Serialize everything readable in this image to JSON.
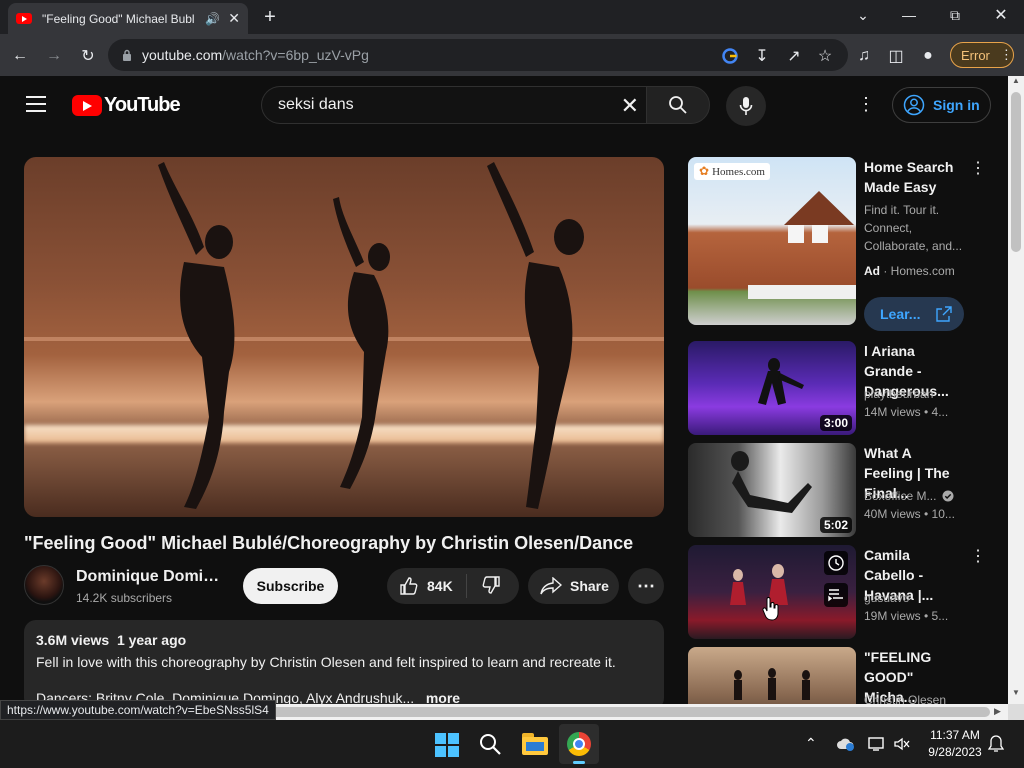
{
  "browser": {
    "tab_title": "\"Feeling Good\" Michael Bubl",
    "url_host": "youtube.com",
    "url_path": "/watch?v=6bp_uzV-vPg",
    "error_label": "Error",
    "status_url": "https://www.youtube.com/watch?v=EbeSNss5lS4"
  },
  "youtube": {
    "logo_text": "YouTube",
    "search_query": "seksi dans",
    "sign_in_label": "Sign in"
  },
  "video": {
    "title": "\"Feeling Good\" Michael Bublé/Choreography by Christin Olesen/Dance",
    "channel_name": "Dominique Domin...",
    "subscribers": "14.2K subscribers",
    "subscribe_label": "Subscribe",
    "likes": "84K",
    "share_label": "Share",
    "views": "3.6M views",
    "age": "1 year ago",
    "description": "Fell in love with this choreography by Christin Olesen and felt inspired to learn and recreate it.",
    "description_line2": "Dancers: Britny Cole, Dominique Domingo, Alyx Andrushuk...",
    "more_label": "more"
  },
  "sidebar": {
    "ad": {
      "title": "Home Search Made Easy",
      "text": "Find it. Tour it. Connect, Collaborate, and...",
      "ad_label": "Ad",
      "domain": "· Homes.com",
      "cta": "Lear...",
      "thumb_brand": "Homes.com"
    },
    "items": [
      {
        "title": "l Ariana Grande - Dangerous...",
        "channel": "playtheurban",
        "meta": "14M views  • 4...",
        "duration": "3:00"
      },
      {
        "title": "What A Feeling | The Final...",
        "channel": "Boxoffice M...",
        "meta": "40M views  • 10...",
        "duration": "5:02"
      },
      {
        "title": "Camila Cabello - Havana |...",
        "channel": "gusuavo",
        "meta": "19M views  • 5...",
        "duration": ""
      },
      {
        "title": "\"FEELING GOOD\" Micha...",
        "channel": "Christin Olesen",
        "meta": "",
        "duration": ""
      }
    ]
  },
  "taskbar": {
    "time": "11:37 AM",
    "date": "9/28/2023"
  }
}
